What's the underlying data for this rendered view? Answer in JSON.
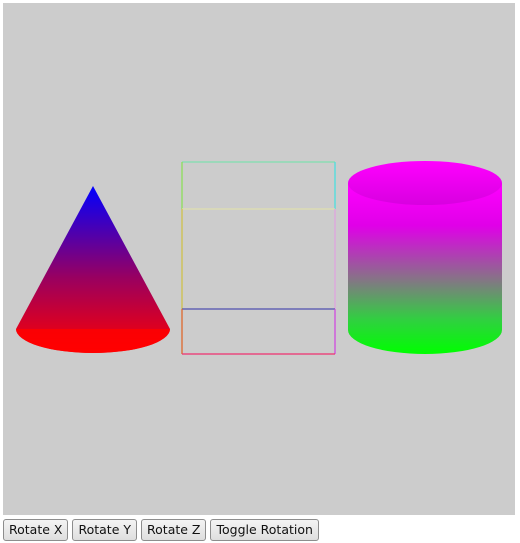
{
  "scene": {
    "background_color": "#cccccc",
    "objects": [
      {
        "name": "cone",
        "apex_color": "#0000ff",
        "base_color": "#ff0000"
      },
      {
        "name": "cube",
        "render_mode": "wireframe"
      },
      {
        "name": "cylinder",
        "top_color": "#ff00ff",
        "bottom_color": "#00ff00"
      }
    ]
  },
  "controls": {
    "rotate_x_label": "Rotate X",
    "rotate_y_label": "Rotate Y",
    "rotate_z_label": "Rotate Z",
    "toggle_rotation_label": "Toggle Rotation"
  }
}
